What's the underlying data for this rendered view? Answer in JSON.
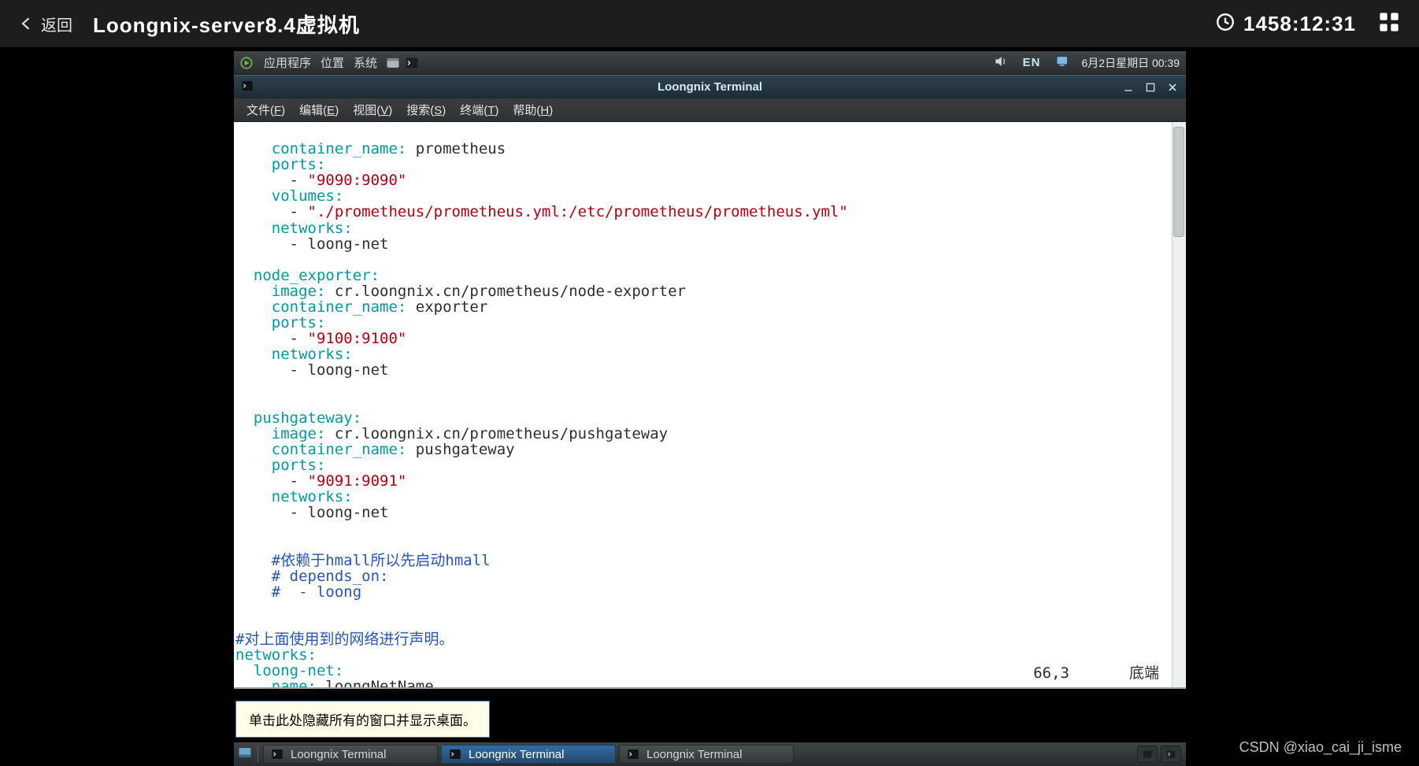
{
  "host": {
    "back_label": "返回",
    "title": "Loongnix-server8.4虚拟机",
    "clock": "1458:12:31"
  },
  "desktop_panel": {
    "apps": "应用程序",
    "places": "位置",
    "system": "系统",
    "ime": "EN",
    "datetime": "6月2日星期日 00:39"
  },
  "terminal": {
    "title": "Loongnix Terminal",
    "menu": {
      "file": "文件(",
      "file_u": "F",
      "file_end": ")",
      "edit": "编辑(",
      "edit_u": "E",
      "edit_end": ")",
      "view": "视图(",
      "view_u": "V",
      "view_end": ")",
      "search": "搜索(",
      "search_u": "S",
      "search_end": ")",
      "terminal": "终端(",
      "terminal_u": "T",
      "terminal_end": ")",
      "help": "帮助(",
      "help_u": "H",
      "help_end": ")"
    },
    "status_pos": "66,3",
    "status_mode": "底端",
    "yaml": {
      "l01_k": "    container_name:",
      "l01_v": " prometheus",
      "l02_k": "    ports:",
      "l03_d": "      - ",
      "l03_s": "\"9090:9090\"",
      "l04_k": "    volumes:",
      "l05_d": "      - ",
      "l05_s": "\"./prometheus/prometheus.yml:/etc/prometheus/prometheus.yml\"",
      "l06_k": "    networks:",
      "l07_d": "      - ",
      "l07_v": "loong-net",
      "l08": "",
      "l09_k": "  node_exporter:",
      "l10_k": "    image:",
      "l10_v": " cr.loongnix.cn/prometheus/node-exporter",
      "l11_k": "    container_name:",
      "l11_v": " exporter",
      "l12_k": "    ports:",
      "l13_d": "      - ",
      "l13_s": "\"9100:9100\"",
      "l14_k": "    networks:",
      "l15_d": "      - ",
      "l15_v": "loong-net",
      "l16": "",
      "l17": "",
      "l18_k": "  pushgateway:",
      "l19_k": "    image:",
      "l19_v": " cr.loongnix.cn/prometheus/pushgateway",
      "l20_k": "    container_name:",
      "l20_v": " pushgateway",
      "l21_k": "    ports:",
      "l22_d": "      - ",
      "l22_s": "\"9091:9091\"",
      "l23_k": "    networks:",
      "l24_d": "      - ",
      "l24_v": "loong-net",
      "l25": "",
      "l26": "",
      "l27_c": "    #依赖于hmall所以先启动hmall",
      "l28_c": "    # depends_on:",
      "l29_c": "    #  - loong",
      "l30": "",
      "l31": "",
      "l32_c": "#对上面使用到的网络进行声明。",
      "l33_k": "networks:",
      "l34_k": "  loong-net:",
      "l35_k": "    name:",
      "l35_v": " loongNetName"
    }
  },
  "tooltip": "单击此处隐藏所有的窗口并显示桌面。",
  "taskbar": {
    "task1": "Loongnix Terminal",
    "task2": "Loongnix Terminal",
    "task3": "Loongnix Terminal"
  },
  "watermark": "CSDN @xiao_cai_ji_isme"
}
